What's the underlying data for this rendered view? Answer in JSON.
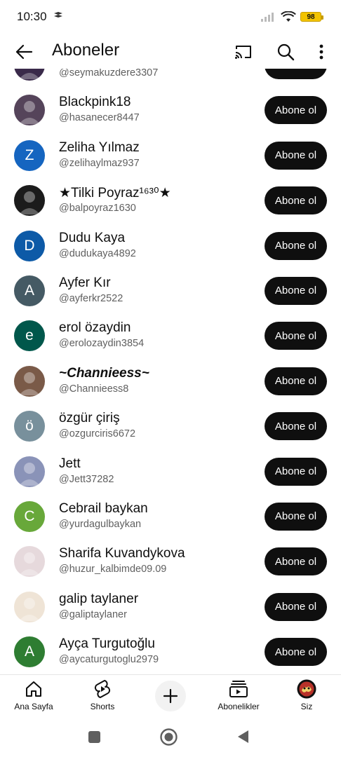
{
  "status": {
    "time": "10:30",
    "battery": "98"
  },
  "appbar": {
    "title": "Aboneler"
  },
  "subscribe_label": "Abone ol",
  "subscribers": [
    {
      "name": "",
      "handle": "@seymakuzdere3307",
      "avatar_type": "photo",
      "avatar_color": "#3a2a4a"
    },
    {
      "name": "Blackpink18",
      "handle": "@hasanecer8447",
      "avatar_type": "photo",
      "avatar_color": "#55445a"
    },
    {
      "name": "Zeliha Yılmaz",
      "handle": "@zelihaylmaz937",
      "avatar_type": "letter",
      "letter": "Z",
      "avatar_color": "#1565c0"
    },
    {
      "name": "★Tilki Poyraz¹⁶³⁰★",
      "handle": "@balpoyraz1630",
      "avatar_type": "photo",
      "avatar_color": "#1b1b1b"
    },
    {
      "name": "Dudu Kaya",
      "handle": "@dudukaya4892",
      "avatar_type": "letter",
      "letter": "D",
      "avatar_color": "#0d5aa7"
    },
    {
      "name": "Ayfer Kır",
      "handle": "@ayferkr2522",
      "avatar_type": "letter",
      "letter": "A",
      "avatar_color": "#455a64"
    },
    {
      "name": "erol özaydin",
      "handle": "@erolozaydin3854",
      "avatar_type": "letter",
      "letter": "e",
      "avatar_color": "#00574b"
    },
    {
      "name": "~Channieess~",
      "handle": "@Channieess8",
      "avatar_type": "photo",
      "avatar_color": "#7a5a48",
      "styled": true
    },
    {
      "name": "özgür çiriş",
      "handle": "@ozgurciris6672",
      "avatar_type": "letter",
      "letter": "ö",
      "avatar_color": "#78909c"
    },
    {
      "name": "Jett",
      "handle": "@Jett37282",
      "avatar_type": "photo",
      "avatar_color": "#8a93b8"
    },
    {
      "name": "Cebrail baykan",
      "handle": "@yurdagulbaykan",
      "avatar_type": "letter",
      "letter": "C",
      "avatar_color": "#68a83a"
    },
    {
      "name": "Sharifa Kuvandykova",
      "handle": "@huzur_kalbimde09.09",
      "avatar_type": "photo",
      "avatar_color": "#e6d9dc"
    },
    {
      "name": "galip taylaner",
      "handle": "@galiptaylaner",
      "avatar_type": "photo",
      "avatar_color": "#efe4d6"
    },
    {
      "name": "Ayça Turgutoğlu",
      "handle": "@aycaturgutoglu2979",
      "avatar_type": "letter",
      "letter": "A",
      "avatar_color": "#2e7d32"
    }
  ],
  "bottom_nav": [
    {
      "label": "Ana Sayfa",
      "icon": "home-icon"
    },
    {
      "label": "Shorts",
      "icon": "shorts-icon"
    },
    {
      "label": "",
      "icon": "create-icon"
    },
    {
      "label": "Abonelikler",
      "icon": "subscriptions-icon"
    },
    {
      "label": "Siz",
      "icon": "profile-avatar"
    }
  ]
}
